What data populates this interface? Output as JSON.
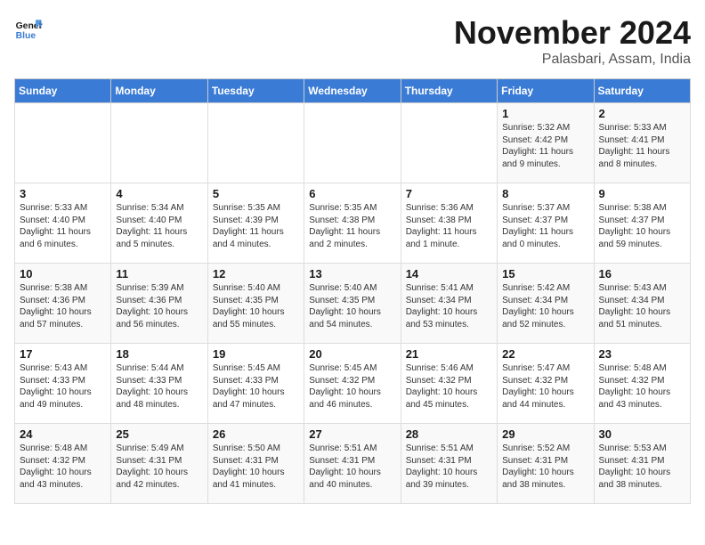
{
  "logo": {
    "line1": "General",
    "line2": "Blue"
  },
  "header": {
    "month": "November 2024",
    "location": "Palasbari, Assam, India"
  },
  "weekdays": [
    "Sunday",
    "Monday",
    "Tuesday",
    "Wednesday",
    "Thursday",
    "Friday",
    "Saturday"
  ],
  "weeks": [
    [
      {
        "day": "",
        "info": ""
      },
      {
        "day": "",
        "info": ""
      },
      {
        "day": "",
        "info": ""
      },
      {
        "day": "",
        "info": ""
      },
      {
        "day": "",
        "info": ""
      },
      {
        "day": "1",
        "info": "Sunrise: 5:32 AM\nSunset: 4:42 PM\nDaylight: 11 hours and 9 minutes."
      },
      {
        "day": "2",
        "info": "Sunrise: 5:33 AM\nSunset: 4:41 PM\nDaylight: 11 hours and 8 minutes."
      }
    ],
    [
      {
        "day": "3",
        "info": "Sunrise: 5:33 AM\nSunset: 4:40 PM\nDaylight: 11 hours and 6 minutes."
      },
      {
        "day": "4",
        "info": "Sunrise: 5:34 AM\nSunset: 4:40 PM\nDaylight: 11 hours and 5 minutes."
      },
      {
        "day": "5",
        "info": "Sunrise: 5:35 AM\nSunset: 4:39 PM\nDaylight: 11 hours and 4 minutes."
      },
      {
        "day": "6",
        "info": "Sunrise: 5:35 AM\nSunset: 4:38 PM\nDaylight: 11 hours and 2 minutes."
      },
      {
        "day": "7",
        "info": "Sunrise: 5:36 AM\nSunset: 4:38 PM\nDaylight: 11 hours and 1 minute."
      },
      {
        "day": "8",
        "info": "Sunrise: 5:37 AM\nSunset: 4:37 PM\nDaylight: 11 hours and 0 minutes."
      },
      {
        "day": "9",
        "info": "Sunrise: 5:38 AM\nSunset: 4:37 PM\nDaylight: 10 hours and 59 minutes."
      }
    ],
    [
      {
        "day": "10",
        "info": "Sunrise: 5:38 AM\nSunset: 4:36 PM\nDaylight: 10 hours and 57 minutes."
      },
      {
        "day": "11",
        "info": "Sunrise: 5:39 AM\nSunset: 4:36 PM\nDaylight: 10 hours and 56 minutes."
      },
      {
        "day": "12",
        "info": "Sunrise: 5:40 AM\nSunset: 4:35 PM\nDaylight: 10 hours and 55 minutes."
      },
      {
        "day": "13",
        "info": "Sunrise: 5:40 AM\nSunset: 4:35 PM\nDaylight: 10 hours and 54 minutes."
      },
      {
        "day": "14",
        "info": "Sunrise: 5:41 AM\nSunset: 4:34 PM\nDaylight: 10 hours and 53 minutes."
      },
      {
        "day": "15",
        "info": "Sunrise: 5:42 AM\nSunset: 4:34 PM\nDaylight: 10 hours and 52 minutes."
      },
      {
        "day": "16",
        "info": "Sunrise: 5:43 AM\nSunset: 4:34 PM\nDaylight: 10 hours and 51 minutes."
      }
    ],
    [
      {
        "day": "17",
        "info": "Sunrise: 5:43 AM\nSunset: 4:33 PM\nDaylight: 10 hours and 49 minutes."
      },
      {
        "day": "18",
        "info": "Sunrise: 5:44 AM\nSunset: 4:33 PM\nDaylight: 10 hours and 48 minutes."
      },
      {
        "day": "19",
        "info": "Sunrise: 5:45 AM\nSunset: 4:33 PM\nDaylight: 10 hours and 47 minutes."
      },
      {
        "day": "20",
        "info": "Sunrise: 5:45 AM\nSunset: 4:32 PM\nDaylight: 10 hours and 46 minutes."
      },
      {
        "day": "21",
        "info": "Sunrise: 5:46 AM\nSunset: 4:32 PM\nDaylight: 10 hours and 45 minutes."
      },
      {
        "day": "22",
        "info": "Sunrise: 5:47 AM\nSunset: 4:32 PM\nDaylight: 10 hours and 44 minutes."
      },
      {
        "day": "23",
        "info": "Sunrise: 5:48 AM\nSunset: 4:32 PM\nDaylight: 10 hours and 43 minutes."
      }
    ],
    [
      {
        "day": "24",
        "info": "Sunrise: 5:48 AM\nSunset: 4:32 PM\nDaylight: 10 hours and 43 minutes."
      },
      {
        "day": "25",
        "info": "Sunrise: 5:49 AM\nSunset: 4:31 PM\nDaylight: 10 hours and 42 minutes."
      },
      {
        "day": "26",
        "info": "Sunrise: 5:50 AM\nSunset: 4:31 PM\nDaylight: 10 hours and 41 minutes."
      },
      {
        "day": "27",
        "info": "Sunrise: 5:51 AM\nSunset: 4:31 PM\nDaylight: 10 hours and 40 minutes."
      },
      {
        "day": "28",
        "info": "Sunrise: 5:51 AM\nSunset: 4:31 PM\nDaylight: 10 hours and 39 minutes."
      },
      {
        "day": "29",
        "info": "Sunrise: 5:52 AM\nSunset: 4:31 PM\nDaylight: 10 hours and 38 minutes."
      },
      {
        "day": "30",
        "info": "Sunrise: 5:53 AM\nSunset: 4:31 PM\nDaylight: 10 hours and 38 minutes."
      }
    ]
  ]
}
